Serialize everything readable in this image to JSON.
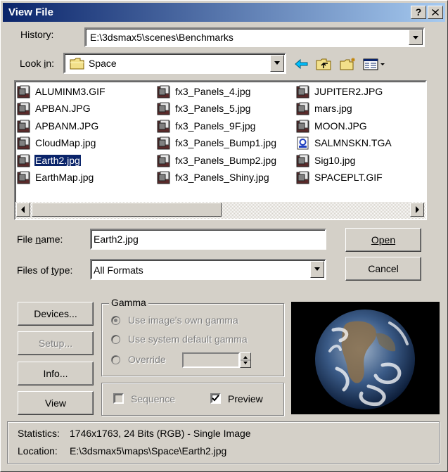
{
  "window": {
    "title": "View File",
    "help_label": "?",
    "close_label": "X"
  },
  "history": {
    "label": "History:",
    "value": "E:\\3dsmax5\\scenes\\Benchmarks"
  },
  "look_in": {
    "label": "Look in:",
    "value": "Space"
  },
  "files": [
    {
      "name": "ALUMINM3.GIF",
      "icon": "image-file-icon"
    },
    {
      "name": "APBAN.JPG",
      "icon": "image-file-icon"
    },
    {
      "name": "APBANM.JPG",
      "icon": "image-file-icon"
    },
    {
      "name": "CloudMap.jpg",
      "icon": "image-file-icon"
    },
    {
      "name": "Earth2.jpg",
      "icon": "image-file-icon",
      "selected": true
    },
    {
      "name": "EarthMap.jpg",
      "icon": "image-file-icon"
    },
    {
      "name": "fx3_Panels_4.jpg",
      "icon": "image-file-icon"
    },
    {
      "name": "fx3_Panels_5.jpg",
      "icon": "image-file-icon"
    },
    {
      "name": "fx3_Panels_9F.jpg",
      "icon": "image-file-icon"
    },
    {
      "name": "fx3_Panels_Bump1.jpg",
      "icon": "image-file-icon"
    },
    {
      "name": "fx3_Panels_Bump2.jpg",
      "icon": "image-file-icon"
    },
    {
      "name": "fx3_Panels_Shiny.jpg",
      "icon": "image-file-icon"
    },
    {
      "name": "JUPITER2.JPG",
      "icon": "image-file-icon"
    },
    {
      "name": "mars.jpg",
      "icon": "image-file-icon"
    },
    {
      "name": "MOON.JPG",
      "icon": "image-file-icon"
    },
    {
      "name": "SALMNSKN.TGA",
      "icon": "tga-file-icon"
    },
    {
      "name": "Sig10.jpg",
      "icon": "image-file-icon"
    },
    {
      "name": "SPACEPLT.GIF",
      "icon": "image-file-icon"
    }
  ],
  "file_name": {
    "label": "File name:",
    "value": "Earth2.jpg"
  },
  "file_type": {
    "label": "Files of type:",
    "value": "All Formats"
  },
  "buttons": {
    "open": "Open",
    "cancel": "Cancel",
    "devices": "Devices...",
    "setup": "Setup...",
    "info": "Info...",
    "view": "View"
  },
  "gamma": {
    "title": "Gamma",
    "options": [
      "Use image's own gamma",
      "Use system default gamma",
      "Override"
    ],
    "selected": "Use image's own gamma"
  },
  "options": {
    "sequence_label": "Sequence",
    "sequence_checked": false,
    "preview_label": "Preview",
    "preview_checked": true
  },
  "status": {
    "statistics_label": "Statistics:",
    "statistics_value": "1746x1763, 24 Bits (RGB) - Single Image",
    "location_label": "Location:",
    "location_value": "E:\\3dsmax5\\maps\\Space\\Earth2.jpg"
  },
  "colors": {
    "title_start": "#0a246a",
    "title_end": "#a6caf0",
    "face": "#d4d0c8",
    "selection": "#0a246a"
  }
}
